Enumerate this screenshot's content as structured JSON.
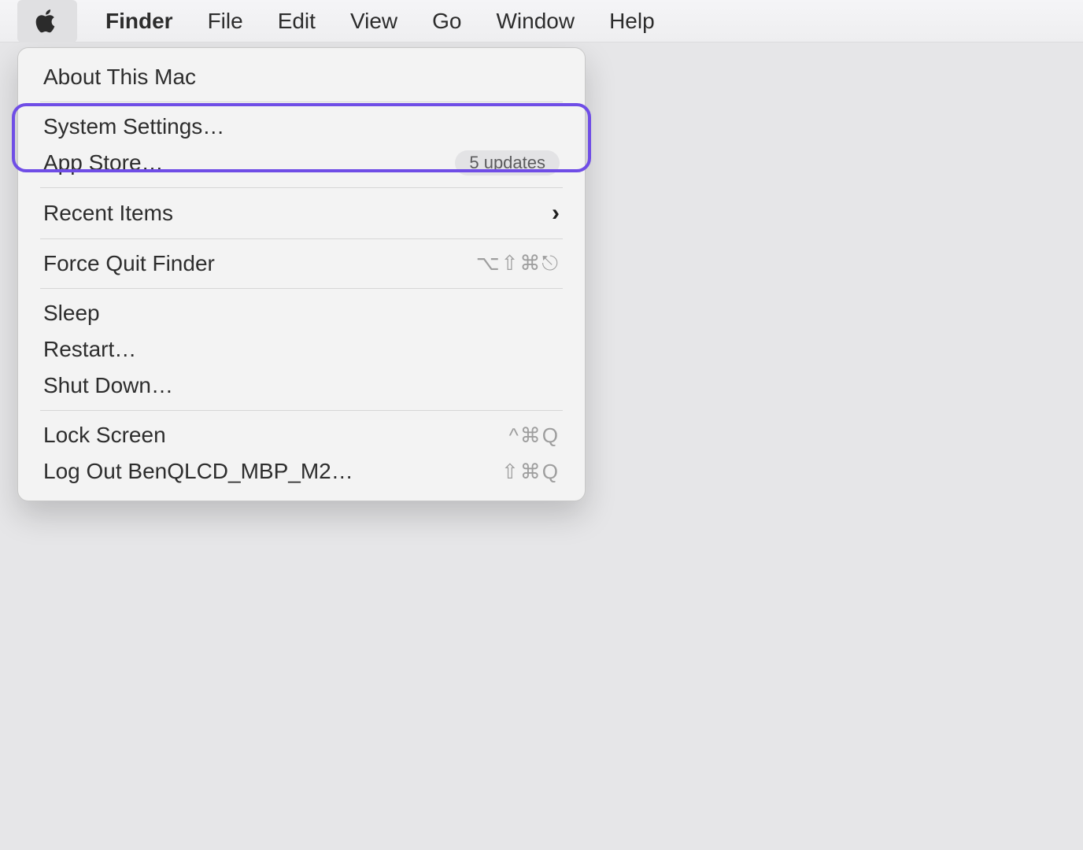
{
  "menubar": {
    "items": [
      {
        "label": "Finder",
        "bold": true
      },
      {
        "label": "File"
      },
      {
        "label": "Edit"
      },
      {
        "label": "View"
      },
      {
        "label": "Go"
      },
      {
        "label": "Window"
      },
      {
        "label": "Help"
      }
    ]
  },
  "apple_menu": {
    "about": "About This Mac",
    "system_settings": "System Settings…",
    "app_store": "App Store…",
    "app_store_badge": "5 updates",
    "recent_items": "Recent Items",
    "force_quit": "Force Quit Finder",
    "force_quit_shortcut": "⌥⇧⌘⎋",
    "sleep": "Sleep",
    "restart": "Restart…",
    "shut_down": "Shut Down…",
    "lock_screen": "Lock Screen",
    "lock_screen_shortcut": "^⌘Q",
    "log_out": "Log Out BenQLCD_MBP_M2…",
    "log_out_shortcut": "⇧⌘Q"
  },
  "highlight_color": "#6f4de6"
}
